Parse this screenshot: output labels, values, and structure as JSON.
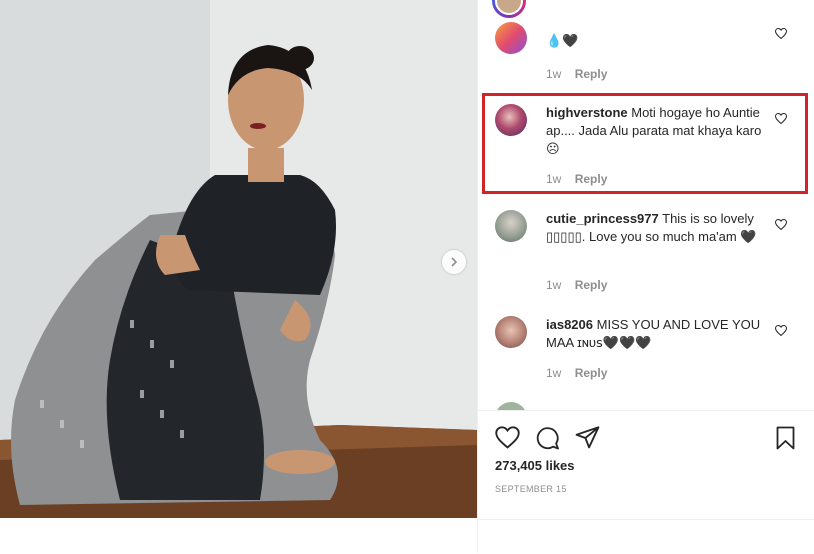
{
  "post": {
    "comments": [
      {
        "user": "",
        "text": "💧🖤",
        "time": "1w",
        "reply": "Reply",
        "avatar_color": "#e24c6e"
      },
      {
        "user": "highverstone",
        "text": "Moti hogaye ho Auntie ap.... Jada Alu parata mat khaya karo ☹",
        "time": "1w",
        "reply": "Reply",
        "avatar_color": "#7a2c4d"
      },
      {
        "user": "cutie_princess977",
        "text": "This is so lovely ▯▯▯▯▯. Love you so much ma'am 🖤",
        "time": "1w",
        "reply": "Reply",
        "avatar_color": "#9aa39a"
      },
      {
        "user": "ias8206",
        "text": "MISS YOU AND LOVE YOU MAA ɪɴᴜꜱ🖤🖤🖤",
        "time": "1w",
        "reply": "Reply",
        "avatar_color": "#b98a7b"
      }
    ],
    "likes": "273,405 likes",
    "date": "SEPTEMBER 15",
    "highlight_color": "#d2232a"
  }
}
